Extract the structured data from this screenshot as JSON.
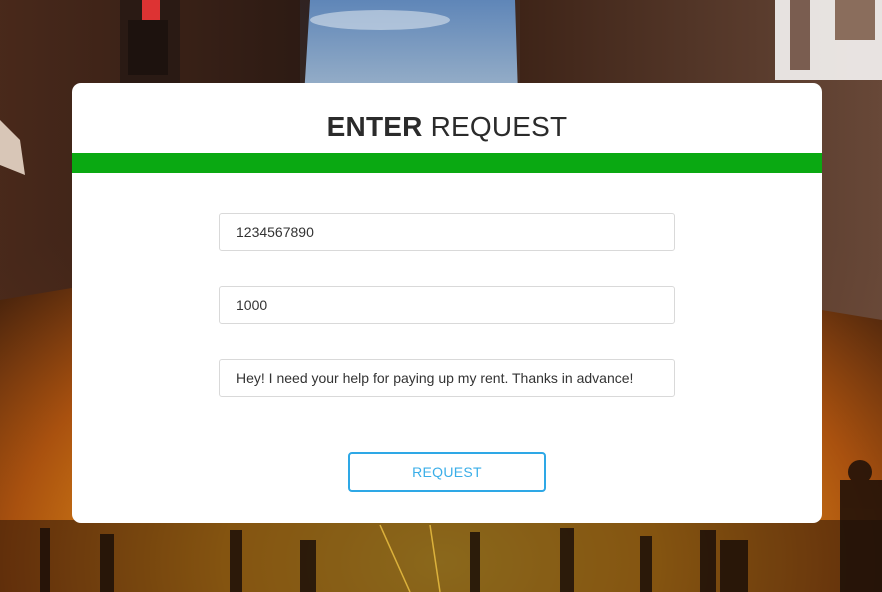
{
  "form": {
    "title_bold": "ENTER",
    "title_rest": "REQUEST",
    "accent_color": "#0aa912",
    "fields": [
      {
        "value": "1234567890",
        "placeholder": ""
      },
      {
        "value": "1000",
        "placeholder": ""
      },
      {
        "value": "Hey! I need your help for paying up my rent. Thanks in advance!",
        "placeholder": ""
      }
    ],
    "submit_label": "REQUEST",
    "submit_color": "#2ea8e6"
  }
}
